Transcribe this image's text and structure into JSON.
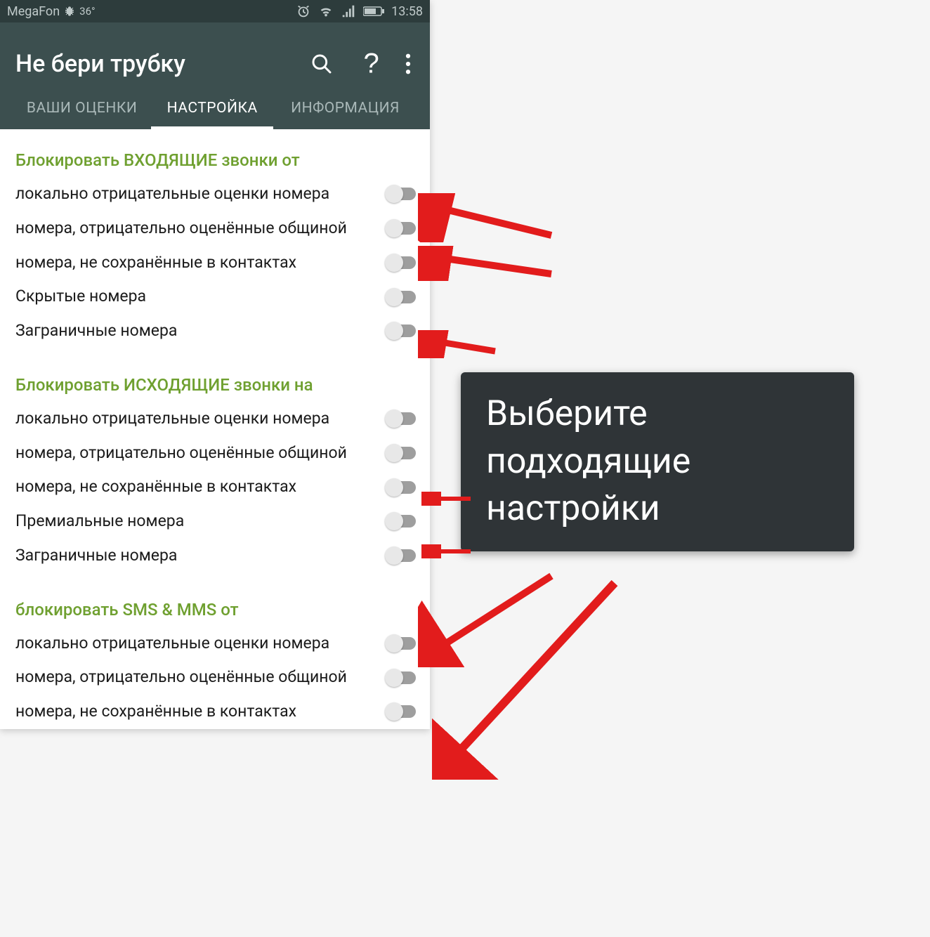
{
  "statusbar": {
    "carrier": "MegaFon",
    "temp": "36°",
    "time": "13:58"
  },
  "appbar": {
    "title": "Не бери трубку"
  },
  "tabs": {
    "0": {
      "label": "ВАШИ ОЦЕНКИ"
    },
    "1": {
      "label": "НАСТРОЙКА"
    },
    "2": {
      "label": "ИНФОРМАЦИЯ"
    }
  },
  "sections": {
    "incoming": {
      "title": "Блокировать ВХОДЯЩИЕ звонки от",
      "items": {
        "0": "локально отрицательные оценки номера",
        "1": "номера, отрицательно оценённые общиной",
        "2": "номера, не сохранённые в контактах",
        "3": "Скрытые номера",
        "4": "Заграничные номера"
      }
    },
    "outgoing": {
      "title": "Блокировать ИСХОДЯЩИЕ звонки на",
      "items": {
        "0": "локально отрицательные оценки номера",
        "1": "номера, отрицательно оценённые общиной",
        "2": "номера, не сохранённые в контактах",
        "3": "Премиальные номера",
        "4": "Заграничные номера"
      }
    },
    "sms": {
      "title": "блокировать SMS & MMS от",
      "items": {
        "0": "локально отрицательные оценки номера",
        "1": "номера, отрицательно оценённые общиной",
        "2": "номера, не сохранённые в контактах"
      }
    }
  },
  "tooltip": "Выберите подходящие настройки"
}
